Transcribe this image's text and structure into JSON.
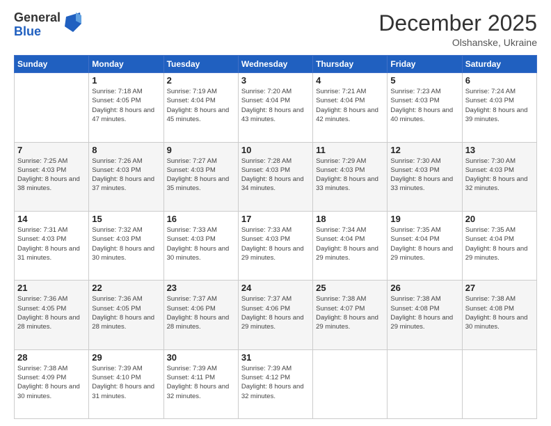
{
  "logo": {
    "general": "General",
    "blue": "Blue"
  },
  "header": {
    "month": "December 2025",
    "location": "Olshanske, Ukraine"
  },
  "days_of_week": [
    "Sunday",
    "Monday",
    "Tuesday",
    "Wednesday",
    "Thursday",
    "Friday",
    "Saturday"
  ],
  "weeks": [
    [
      {
        "day": "",
        "sunrise": "",
        "sunset": "",
        "daylight": ""
      },
      {
        "day": "1",
        "sunrise": "Sunrise: 7:18 AM",
        "sunset": "Sunset: 4:05 PM",
        "daylight": "Daylight: 8 hours and 47 minutes."
      },
      {
        "day": "2",
        "sunrise": "Sunrise: 7:19 AM",
        "sunset": "Sunset: 4:04 PM",
        "daylight": "Daylight: 8 hours and 45 minutes."
      },
      {
        "day": "3",
        "sunrise": "Sunrise: 7:20 AM",
        "sunset": "Sunset: 4:04 PM",
        "daylight": "Daylight: 8 hours and 43 minutes."
      },
      {
        "day": "4",
        "sunrise": "Sunrise: 7:21 AM",
        "sunset": "Sunset: 4:04 PM",
        "daylight": "Daylight: 8 hours and 42 minutes."
      },
      {
        "day": "5",
        "sunrise": "Sunrise: 7:23 AM",
        "sunset": "Sunset: 4:03 PM",
        "daylight": "Daylight: 8 hours and 40 minutes."
      },
      {
        "day": "6",
        "sunrise": "Sunrise: 7:24 AM",
        "sunset": "Sunset: 4:03 PM",
        "daylight": "Daylight: 8 hours and 39 minutes."
      }
    ],
    [
      {
        "day": "7",
        "sunrise": "Sunrise: 7:25 AM",
        "sunset": "Sunset: 4:03 PM",
        "daylight": "Daylight: 8 hours and 38 minutes."
      },
      {
        "day": "8",
        "sunrise": "Sunrise: 7:26 AM",
        "sunset": "Sunset: 4:03 PM",
        "daylight": "Daylight: 8 hours and 37 minutes."
      },
      {
        "day": "9",
        "sunrise": "Sunrise: 7:27 AM",
        "sunset": "Sunset: 4:03 PM",
        "daylight": "Daylight: 8 hours and 35 minutes."
      },
      {
        "day": "10",
        "sunrise": "Sunrise: 7:28 AM",
        "sunset": "Sunset: 4:03 PM",
        "daylight": "Daylight: 8 hours and 34 minutes."
      },
      {
        "day": "11",
        "sunrise": "Sunrise: 7:29 AM",
        "sunset": "Sunset: 4:03 PM",
        "daylight": "Daylight: 8 hours and 33 minutes."
      },
      {
        "day": "12",
        "sunrise": "Sunrise: 7:30 AM",
        "sunset": "Sunset: 4:03 PM",
        "daylight": "Daylight: 8 hours and 33 minutes."
      },
      {
        "day": "13",
        "sunrise": "Sunrise: 7:30 AM",
        "sunset": "Sunset: 4:03 PM",
        "daylight": "Daylight: 8 hours and 32 minutes."
      }
    ],
    [
      {
        "day": "14",
        "sunrise": "Sunrise: 7:31 AM",
        "sunset": "Sunset: 4:03 PM",
        "daylight": "Daylight: 8 hours and 31 minutes."
      },
      {
        "day": "15",
        "sunrise": "Sunrise: 7:32 AM",
        "sunset": "Sunset: 4:03 PM",
        "daylight": "Daylight: 8 hours and 30 minutes."
      },
      {
        "day": "16",
        "sunrise": "Sunrise: 7:33 AM",
        "sunset": "Sunset: 4:03 PM",
        "daylight": "Daylight: 8 hours and 30 minutes."
      },
      {
        "day": "17",
        "sunrise": "Sunrise: 7:33 AM",
        "sunset": "Sunset: 4:03 PM",
        "daylight": "Daylight: 8 hours and 29 minutes."
      },
      {
        "day": "18",
        "sunrise": "Sunrise: 7:34 AM",
        "sunset": "Sunset: 4:04 PM",
        "daylight": "Daylight: 8 hours and 29 minutes."
      },
      {
        "day": "19",
        "sunrise": "Sunrise: 7:35 AM",
        "sunset": "Sunset: 4:04 PM",
        "daylight": "Daylight: 8 hours and 29 minutes."
      },
      {
        "day": "20",
        "sunrise": "Sunrise: 7:35 AM",
        "sunset": "Sunset: 4:04 PM",
        "daylight": "Daylight: 8 hours and 29 minutes."
      }
    ],
    [
      {
        "day": "21",
        "sunrise": "Sunrise: 7:36 AM",
        "sunset": "Sunset: 4:05 PM",
        "daylight": "Daylight: 8 hours and 28 minutes."
      },
      {
        "day": "22",
        "sunrise": "Sunrise: 7:36 AM",
        "sunset": "Sunset: 4:05 PM",
        "daylight": "Daylight: 8 hours and 28 minutes."
      },
      {
        "day": "23",
        "sunrise": "Sunrise: 7:37 AM",
        "sunset": "Sunset: 4:06 PM",
        "daylight": "Daylight: 8 hours and 28 minutes."
      },
      {
        "day": "24",
        "sunrise": "Sunrise: 7:37 AM",
        "sunset": "Sunset: 4:06 PM",
        "daylight": "Daylight: 8 hours and 29 minutes."
      },
      {
        "day": "25",
        "sunrise": "Sunrise: 7:38 AM",
        "sunset": "Sunset: 4:07 PM",
        "daylight": "Daylight: 8 hours and 29 minutes."
      },
      {
        "day": "26",
        "sunrise": "Sunrise: 7:38 AM",
        "sunset": "Sunset: 4:08 PM",
        "daylight": "Daylight: 8 hours and 29 minutes."
      },
      {
        "day": "27",
        "sunrise": "Sunrise: 7:38 AM",
        "sunset": "Sunset: 4:08 PM",
        "daylight": "Daylight: 8 hours and 30 minutes."
      }
    ],
    [
      {
        "day": "28",
        "sunrise": "Sunrise: 7:38 AM",
        "sunset": "Sunset: 4:09 PM",
        "daylight": "Daylight: 8 hours and 30 minutes."
      },
      {
        "day": "29",
        "sunrise": "Sunrise: 7:39 AM",
        "sunset": "Sunset: 4:10 PM",
        "daylight": "Daylight: 8 hours and 31 minutes."
      },
      {
        "day": "30",
        "sunrise": "Sunrise: 7:39 AM",
        "sunset": "Sunset: 4:11 PM",
        "daylight": "Daylight: 8 hours and 32 minutes."
      },
      {
        "day": "31",
        "sunrise": "Sunrise: 7:39 AM",
        "sunset": "Sunset: 4:12 PM",
        "daylight": "Daylight: 8 hours and 32 minutes."
      },
      {
        "day": "",
        "sunrise": "",
        "sunset": "",
        "daylight": ""
      },
      {
        "day": "",
        "sunrise": "",
        "sunset": "",
        "daylight": ""
      },
      {
        "day": "",
        "sunrise": "",
        "sunset": "",
        "daylight": ""
      }
    ]
  ]
}
